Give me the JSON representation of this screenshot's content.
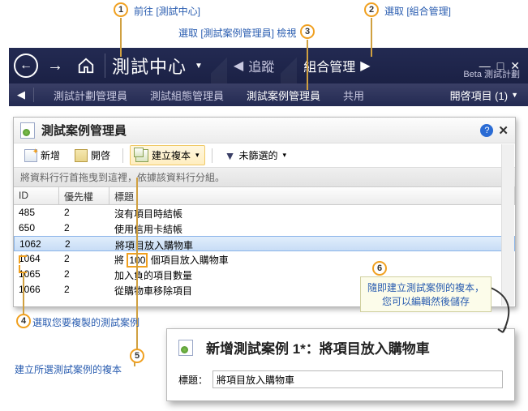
{
  "callouts": {
    "1": "前往 [測試中心]",
    "2": "選取 [組合管理]",
    "3": "選取 [測試案例管理員] 檢視",
    "4": "選取您要複製的測試案例",
    "5": "建立所選測試案例的複本",
    "6_line1": "隨即建立測試案例的複本，",
    "6_line2": "您可以編輯然後儲存"
  },
  "appbar": {
    "title": "測試中心",
    "tab_track": "追蹤",
    "tab_org": "組合管理",
    "beta": "Beta 測試計劃"
  },
  "subbar": {
    "plan_mgr": "測試計劃管理員",
    "config_mgr": "測試組態管理員",
    "case_mgr": "測試案例管理員",
    "share": "共用",
    "open_items": "開啓項目 (1)"
  },
  "panel": {
    "title": "測試案例管理員",
    "toolbar": {
      "new": "新增",
      "open": "開啓",
      "copy": "建立複本",
      "filter": "未篩選的"
    },
    "group_hint": "將資料行行首拖曳到這裡，依據該資料行分組。",
    "cols": {
      "id": "ID",
      "priority": "優先權",
      "title": "標題"
    },
    "rows": [
      {
        "id": "485",
        "pri": "2",
        "title": "沒有項目時結帳"
      },
      {
        "id": "650",
        "pri": "2",
        "title": "使用信用卡結帳"
      },
      {
        "id": "1062",
        "pri": "2",
        "title": "將項目放入購物車",
        "selected": true
      },
      {
        "id": "1064",
        "pri": "2",
        "title_pre": "將 ",
        "title_hl": "100",
        "title_post": " 個項目放入購物車"
      },
      {
        "id": "1065",
        "pri": "2",
        "title": "加入負的項目數量"
      },
      {
        "id": "1066",
        "pri": "2",
        "title": "從購物車移除項目"
      }
    ]
  },
  "popup": {
    "title": "新增測試案例 1*：將項目放入購物車",
    "field_label": "標題：",
    "field_value": "將項目放入購物車"
  }
}
